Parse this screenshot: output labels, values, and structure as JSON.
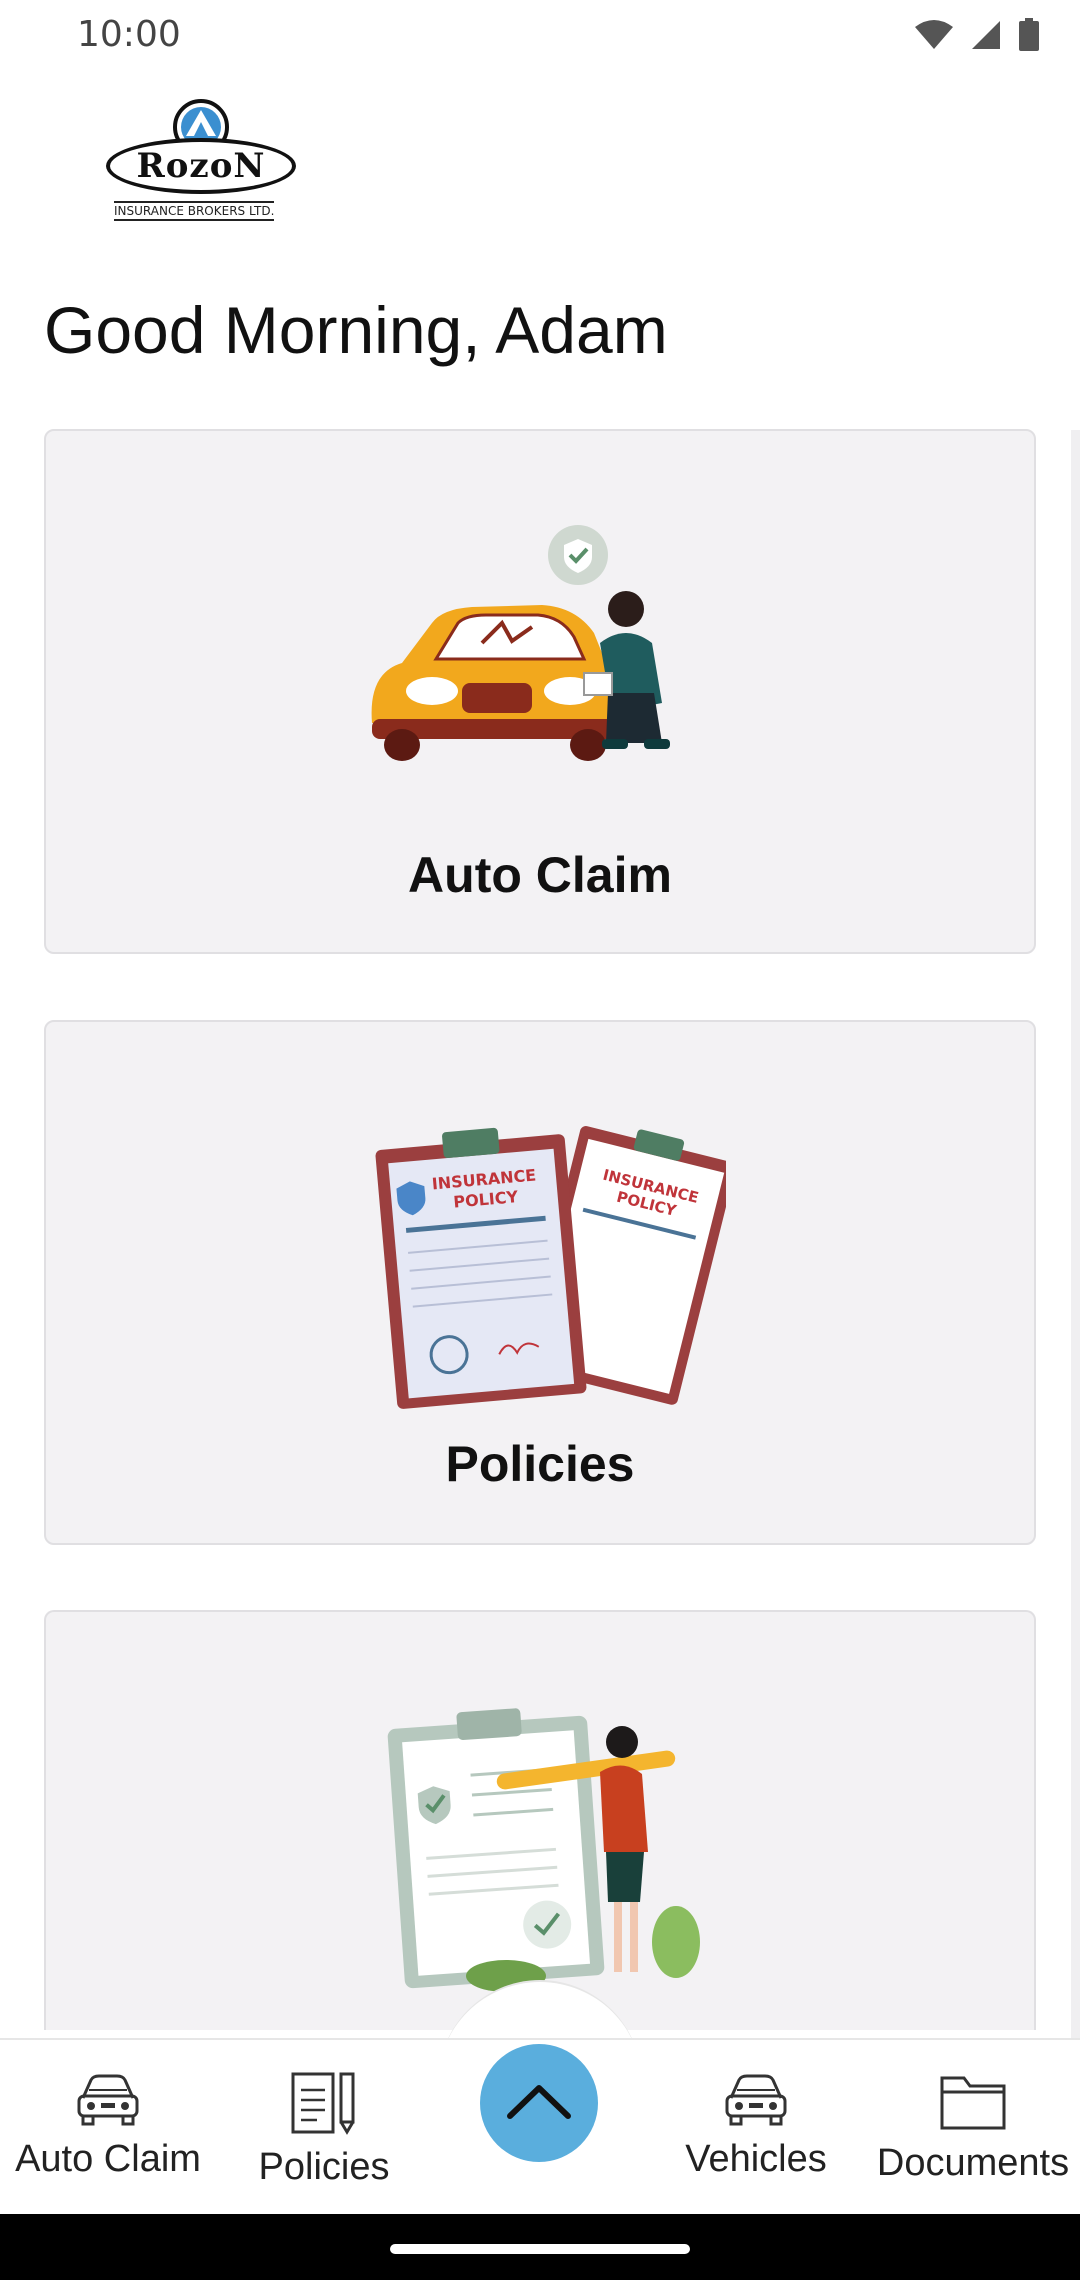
{
  "status_bar": {
    "time": "10:00",
    "icons": [
      "wifi-icon",
      "cellular-signal-icon",
      "battery-icon"
    ]
  },
  "logo": {
    "brand": "RozoN",
    "subtitle": "INSURANCE BROKERS LTD."
  },
  "greeting": "Good Morning, Adam",
  "cards": [
    {
      "title": "Auto Claim",
      "illustration": "car-claim-illustration"
    },
    {
      "title": "Policies",
      "illustration": "insurance-policy-illustration"
    },
    {
      "title": "",
      "illustration": "checklist-illustration"
    }
  ],
  "bottom_nav": {
    "items": [
      {
        "label": "Auto Claim",
        "icon": "car-icon"
      },
      {
        "label": "Policies",
        "icon": "document-pen-icon"
      },
      {
        "label": "Vehicles",
        "icon": "car-icon"
      },
      {
        "label": "Documents",
        "icon": "folder-icon"
      }
    ],
    "fab_icon": "chevron-up-icon"
  },
  "colors": {
    "accent": "#5aaedd",
    "card_bg": "#f3f2f4",
    "card_border": "#e0dfe2"
  }
}
